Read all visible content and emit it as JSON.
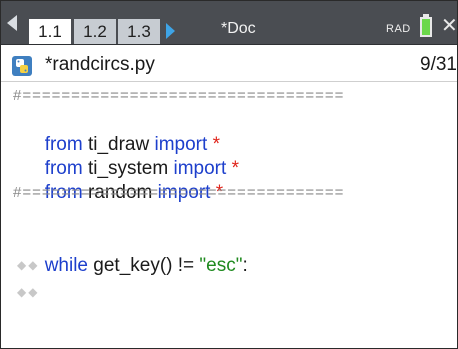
{
  "topbar": {
    "tabs": [
      {
        "label": "1.1",
        "active": true
      },
      {
        "label": "1.2",
        "active": false
      },
      {
        "label": "1.3",
        "active": false
      }
    ],
    "doc_title": "*Doc",
    "mode": "RAD",
    "battery_color": "#6bd84a",
    "close_glyph": "✕"
  },
  "file": {
    "name": "*randcircs.py",
    "line_count": "9/31"
  },
  "code": {
    "divider": "#=================================",
    "line_2": {
      "kw": "from",
      "mod": " ti_draw ",
      "imp": "import",
      "star": " *"
    },
    "line_3": {
      "kw": "from",
      "mod": " ti_system ",
      "imp": "import",
      "star": " *"
    },
    "line_4": {
      "kw": "from",
      "mod": " random ",
      "imp": "import",
      "star": " *"
    },
    "divider_2": "#=================================",
    "while": {
      "kw": "while",
      "call": " get_key() ",
      "op": "!= ",
      "str": "\"esc\"",
      "colon": ":"
    },
    "indent_marker": "◆◆"
  },
  "colors": {
    "keyword": "#1d3fcc",
    "string": "#1f8a1f",
    "star": "#e0241b",
    "comment": "#8a8a8a"
  }
}
